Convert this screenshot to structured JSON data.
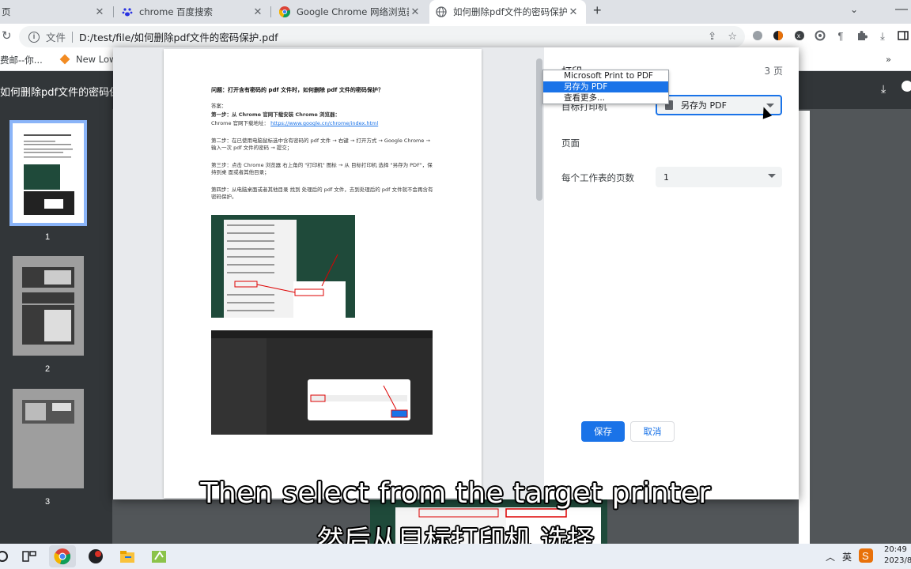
{
  "browser": {
    "tabs": [
      {
        "label": "页",
        "active": false
      },
      {
        "label": "chrome 百度搜索",
        "active": false
      },
      {
        "label": "Google Chrome 网络浏览器",
        "active": false
      },
      {
        "label": "如何删除pdf文件的密码保护.pdf",
        "active": true
      }
    ],
    "address": {
      "prefix": "文件",
      "url": "D:/test/file/如何删除pdf文件的密码保护.pdf"
    },
    "bookmarks": [
      "费邮--你...",
      "New Low..."
    ],
    "more_bookmarks": "»"
  },
  "pdf_viewer": {
    "title": "如何删除pdf文件的密码保护.pdf",
    "thumbnails": [
      "1",
      "2",
      "3"
    ]
  },
  "print_dialog": {
    "title": "打印",
    "page_count": "3 页",
    "destination_label": "目标打印机",
    "destination_value": "另存为 PDF",
    "destination_options": [
      "Microsoft Print to PDF",
      "另存为 PDF",
      "查看更多..."
    ],
    "selected_option_index": 1,
    "pages_label": "页面",
    "sheets_label": "每个工作表的页数",
    "sheets_value": "1",
    "save_button": "保存",
    "cancel_button": "取消"
  },
  "preview": {
    "heading": "问题：打开含有密码的 pdf 文件时，如何删除 pdf 文件的密码保护？",
    "answer": "答案：",
    "step1": "第一步：从 Chrome 官网下载安装 Chrome 浏览器：",
    "step1b": "Chrome 官网下载地址：",
    "step1_link": "https://www.google.cn/chrome/index.html",
    "step2": "第二步：在已使用电脑鼠标选中含有密码的 pdf 文件 → 右键 → 打开方式 → Google Chrome → 输入一次 pdf 文件的密码 → 提交；",
    "step3": "第三步：点击 Chrome 浏览器 右上角的 \"打印机\" 图标 → 从 目标打印机 选择 \"另存为 PDF\"，保持到桌 面或者其他目录；",
    "step4": "第四步：从电脑桌面或者其他目录 找到 处理后的 pdf 文件，去到处理后的 pdf 文件就不会再含有密码保护。"
  },
  "subtitles": {
    "english": "Then select from the target printer",
    "chinese": "然后从目标打印机 选择"
  },
  "taskbar": {
    "ime": "英",
    "time": "20:49",
    "date": "2023/8/"
  },
  "colors": {
    "accent": "#1a73e8",
    "pdf_toolbar": "#323639",
    "pdf_bg": "#525659"
  }
}
